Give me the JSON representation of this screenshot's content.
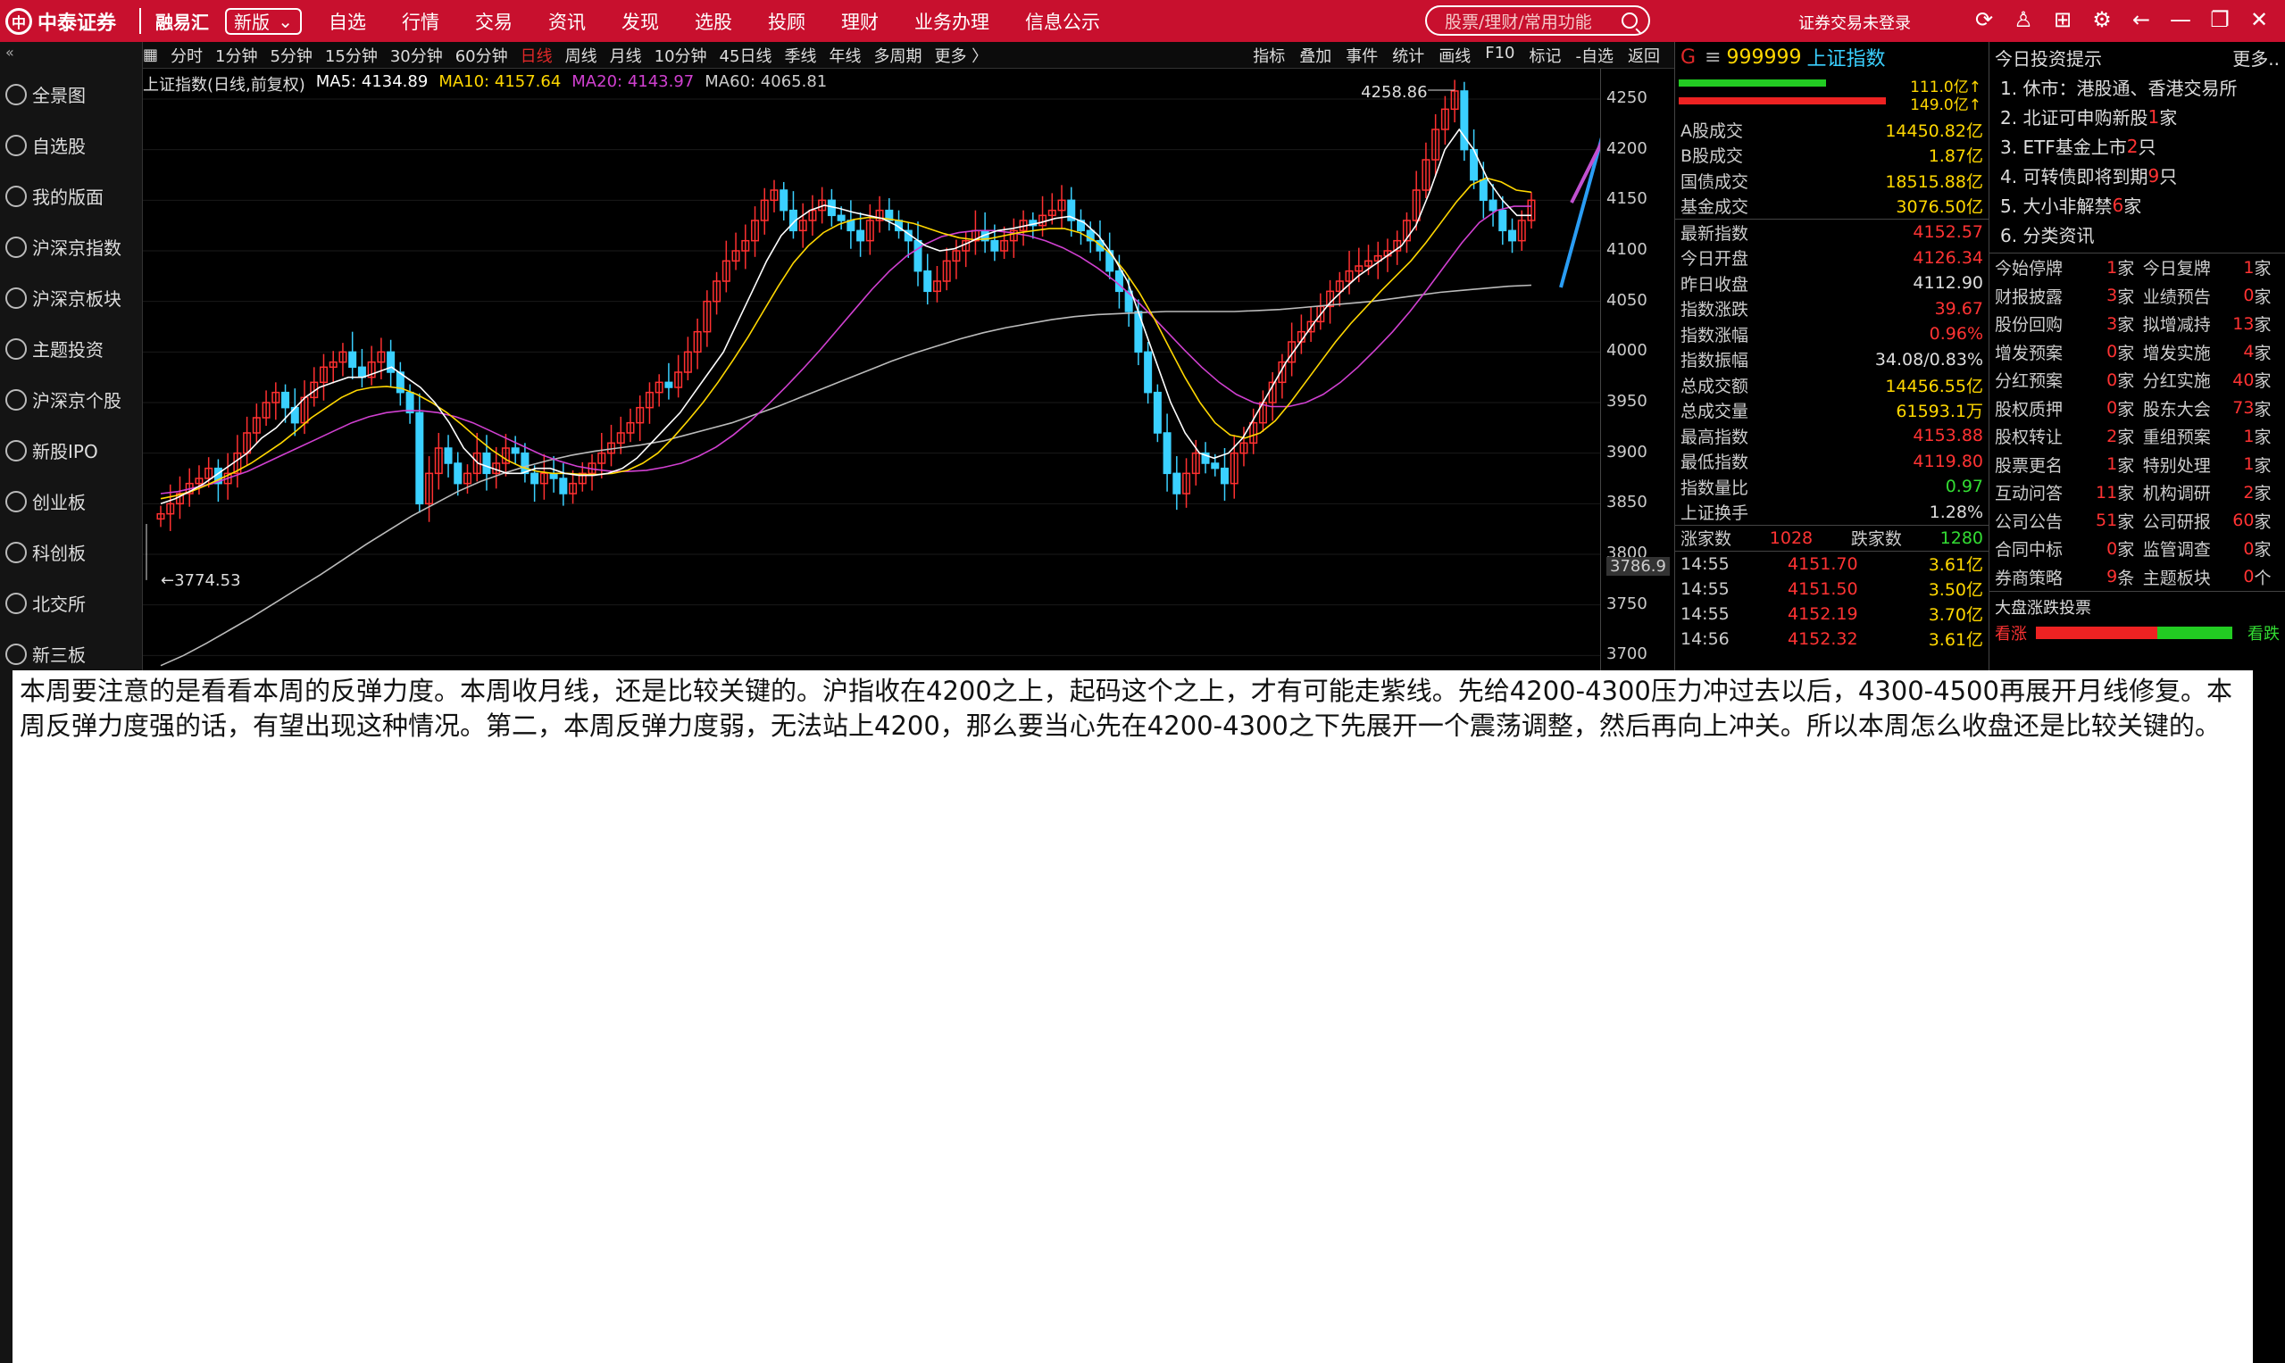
{
  "topbar": {
    "brand": "中泰证券",
    "app": "融易汇",
    "version": "新版",
    "menu": [
      "自选",
      "行情",
      "交易",
      "资讯",
      "发现",
      "选股",
      "投顾",
      "理财",
      "业务办理",
      "信息公示"
    ],
    "search_placeholder": "股票/理财/常用功能",
    "login_status": "证券交易未登录"
  },
  "sidebar": {
    "items": [
      "全景图",
      "自选股",
      "我的版面",
      "沪深京指数",
      "沪深京板块",
      "主题投资",
      "沪深京个股",
      "新股IPO",
      "创业板",
      "科创板",
      "北交所",
      "新三板"
    ]
  },
  "toolbar": {
    "periods": [
      "分时",
      "1分钟",
      "5分钟",
      "15分钟",
      "30分钟",
      "60分钟",
      "日线",
      "周线",
      "月线",
      "10分钟",
      "45日线",
      "季线",
      "年线",
      "多周期",
      "更多 〉"
    ],
    "active": "日线",
    "tools": [
      "指标",
      "叠加",
      "事件",
      "统计",
      "画线",
      "F10",
      "标记",
      "-自选",
      "返回"
    ]
  },
  "chart": {
    "title": "上证指数(日线,前复权)",
    "ma5": "MA5: 4134.89",
    "ma10": "MA10: 4157.64",
    "ma20": "MA20: 4143.97",
    "ma60": "MA60: 4065.81",
    "high_label": "4258.86",
    "low_label": "3774.53",
    "cursor_price": "3786.9",
    "y_ticks": [
      "4250",
      "4200",
      "4150",
      "4100",
      "4050",
      "4000",
      "3950",
      "3900",
      "3850",
      "3800",
      "3750",
      "3700"
    ],
    "colors": {
      "up": "#ff3030",
      "down": "#3ad0ff",
      "ma5": "#ffffff",
      "ma10": "#ffd700",
      "ma20": "#d040d0",
      "ma60": "#bbbbbb"
    }
  },
  "chart_data": {
    "type": "candlestick",
    "title": "上证指数(日线,前复权)",
    "ylim": [
      3680,
      4280
    ],
    "y_ticks": [
      3700,
      3750,
      3800,
      3850,
      3900,
      3950,
      4000,
      4050,
      4100,
      4150,
      4200,
      4250
    ],
    "close": [
      3840,
      3850,
      3860,
      3870,
      3875,
      3885,
      3870,
      3880,
      3900,
      3920,
      3935,
      3950,
      3960,
      3945,
      3930,
      3955,
      3970,
      3985,
      3990,
      4000,
      3985,
      3975,
      3990,
      4000,
      3980,
      3960,
      3940,
      3850,
      3880,
      3905,
      3890,
      3870,
      3880,
      3900,
      3880,
      3890,
      3905,
      3900,
      3880,
      3870,
      3880,
      3875,
      3860,
      3870,
      3880,
      3890,
      3900,
      3910,
      3920,
      3930,
      3945,
      3960,
      3970,
      3965,
      3980,
      4000,
      4020,
      4050,
      4070,
      4090,
      4100,
      4110,
      4130,
      4150,
      4160,
      4140,
      4120,
      4130,
      4140,
      4150,
      4135,
      4130,
      4120,
      4110,
      4130,
      4140,
      4130,
      4120,
      4110,
      4080,
      4060,
      4070,
      4090,
      4100,
      4110,
      4120,
      4110,
      4100,
      4110,
      4120,
      4130,
      4125,
      4135,
      4140,
      4150,
      4130,
      4120,
      4110,
      4100,
      4080,
      4060,
      4040,
      4000,
      3960,
      3920,
      3880,
      3860,
      3880,
      3900,
      3890,
      3885,
      3870,
      3900,
      3910,
      3930,
      3950,
      3970,
      3990,
      4010,
      4020,
      4030,
      4045,
      4060,
      4070,
      4080,
      4085,
      4090,
      4095,
      4100,
      4110,
      4130,
      4160,
      4190,
      4220,
      4240,
      4258,
      4200,
      4170,
      4150,
      4140,
      4120,
      4110,
      4130,
      4150
    ],
    "ma5": [
      3850,
      3855,
      3862,
      3870,
      3880,
      3890,
      3900,
      3915,
      3925,
      3940,
      3955,
      3965,
      3970,
      3975,
      3975,
      3980,
      3985,
      3975,
      3965,
      3950,
      3930,
      3905,
      3890,
      3885,
      3880,
      3880,
      3885,
      3885,
      3880,
      3878,
      3878,
      3880,
      3885,
      3895,
      3910,
      3925,
      3940,
      3960,
      3980,
      4000,
      4030,
      4060,
      4090,
      4115,
      4130,
      4140,
      4145,
      4142,
      4138,
      4135,
      4132,
      4125,
      4115,
      4105,
      4100,
      4102,
      4108,
      4115,
      4120,
      4122,
      4125,
      4128,
      4132,
      4134,
      4128,
      4115,
      4095,
      4070,
      4030,
      3990,
      3950,
      3920,
      3900,
      3895,
      3900,
      3915,
      3940,
      3965,
      3990,
      4010,
      4030,
      4048,
      4062,
      4075,
      4085,
      4095,
      4105,
      4125,
      4160,
      4200,
      4220,
      4200,
      4170,
      4150,
      4135,
      4135
    ],
    "ma10": [
      3855,
      3858,
      3862,
      3868,
      3875,
      3882,
      3890,
      3900,
      3910,
      3922,
      3935,
      3945,
      3955,
      3962,
      3965,
      3966,
      3964,
      3958,
      3950,
      3940,
      3928,
      3915,
      3903,
      3893,
      3886,
      3882,
      3880,
      3880,
      3879,
      3879,
      3880,
      3883,
      3890,
      3900,
      3915,
      3932,
      3950,
      3970,
      3992,
      4015,
      4040,
      4065,
      4088,
      4105,
      4118,
      4126,
      4131,
      4133,
      4132,
      4130,
      4127,
      4122,
      4117,
      4113,
      4111,
      4112,
      4115,
      4118,
      4120,
      4122,
      4122,
      4118,
      4110,
      4098,
      4080,
      4058,
      4032,
      4003,
      3975,
      3950,
      3930,
      3918,
      3915,
      3920,
      3932,
      3950,
      3970,
      3990,
      4010,
      4028,
      4044,
      4060,
      4075,
      4090,
      4108,
      4128,
      4148,
      4165,
      4172,
      4168,
      4160,
      4158
    ],
    "ma20": [
      3860,
      3862,
      3866,
      3870,
      3876,
      3882,
      3890,
      3898,
      3906,
      3914,
      3922,
      3930,
      3936,
      3940,
      3942,
      3942,
      3940,
      3936,
      3930,
      3922,
      3914,
      3906,
      3898,
      3892,
      3887,
      3884,
      3882,
      3882,
      3883,
      3886,
      3890,
      3897,
      3906,
      3918,
      3932,
      3948,
      3965,
      3983,
      4002,
      4022,
      4042,
      4062,
      4080,
      4095,
      4106,
      4114,
      4118,
      4120,
      4120,
      4118,
      4115,
      4110,
      4103,
      4094,
      4083,
      4070,
      4055,
      4038,
      4020,
      4002,
      3985,
      3970,
      3958,
      3950,
      3946,
      3946,
      3950,
      3958,
      3970,
      3985,
      4002,
      4020,
      4040,
      4062,
      4085,
      4108,
      4128,
      4140,
      4144,
      4144
    ],
    "ma60": [
      3690,
      3700,
      3712,
      3725,
      3738,
      3752,
      3766,
      3780,
      3795,
      3810,
      3824,
      3838,
      3850,
      3862,
      3872,
      3880,
      3887,
      3893,
      3898,
      3902,
      3905,
      3908,
      3912,
      3918,
      3924,
      3930,
      3938,
      3946,
      3955,
      3964,
      3973,
      3982,
      3991,
      3999,
      4006,
      4013,
      4019,
      4024,
      4028,
      4032,
      4035,
      4037,
      4038,
      4039,
      4040,
      4040,
      4040,
      4040,
      4041,
      4042,
      4044,
      4046,
      4048,
      4050,
      4053,
      4056,
      4059,
      4061,
      4063,
      4065,
      4066
    ]
  },
  "info": {
    "g": "G",
    "code": "999999",
    "name": "上证指数",
    "bar1_value": "111.0亿↑",
    "bar2_value": "149.0亿↑",
    "turnovers": [
      {
        "label": "A股成交",
        "value": "14450.82亿"
      },
      {
        "label": "B股成交",
        "value": "1.87亿"
      },
      {
        "label": "国债成交",
        "value": "18515.88亿"
      },
      {
        "label": "基金成交",
        "value": "3076.50亿"
      }
    ],
    "stats": [
      {
        "label": "最新指数",
        "value": "4152.57",
        "color": "red"
      },
      {
        "label": "今日开盘",
        "value": "4126.34",
        "color": "red"
      },
      {
        "label": "昨日收盘",
        "value": "4112.90",
        "color": "white"
      },
      {
        "label": "指数涨跌",
        "value": "39.67",
        "color": "red"
      },
      {
        "label": "指数涨幅",
        "value": "0.96%",
        "color": "red"
      },
      {
        "label": "指数振幅",
        "value": "34.08/0.83%",
        "color": "white"
      },
      {
        "label": "总成交额",
        "value": "14456.55亿",
        "color": "yellow"
      },
      {
        "label": "总成交量",
        "value": "61593.1万",
        "color": "yellow"
      },
      {
        "label": "最高指数",
        "value": "4153.88",
        "color": "red"
      },
      {
        "label": "最低指数",
        "value": "4119.80",
        "color": "red"
      },
      {
        "label": "指数量比",
        "value": "0.97",
        "color": "green"
      },
      {
        "label": "上证换手",
        "value": "1.28%",
        "color": "white"
      }
    ],
    "up_label": "涨家数",
    "up_count": "1028",
    "down_label": "跌家数",
    "down_count": "1280",
    "ticks": [
      {
        "t": "14:55",
        "p": "4151.70",
        "v": "3.61亿"
      },
      {
        "t": "14:55",
        "p": "4151.50",
        "v": "3.50亿"
      },
      {
        "t": "14:55",
        "p": "4152.19",
        "v": "3.70亿"
      },
      {
        "t": "14:56",
        "p": "4152.32",
        "v": "3.61亿"
      }
    ]
  },
  "tips": {
    "title": "今日投资提示",
    "more": "更多..",
    "items": [
      {
        "pre": "1. 休市：港股通、香港交易所",
        "num": "",
        "post": ""
      },
      {
        "pre": "2. 北证可申购新股",
        "num": "1",
        "post": "家"
      },
      {
        "pre": "3. ETF基金上市",
        "num": "2",
        "post": "只"
      },
      {
        "pre": "4. 可转债即将到期",
        "num": "9",
        "post": "只"
      },
      {
        "pre": "5. 大小非解禁",
        "num": "6",
        "post": "家"
      },
      {
        "pre": "6. 分类资讯",
        "num": "",
        "post": ""
      }
    ],
    "events": [
      {
        "a": "今始停牌",
        "av": "1",
        "au": "家",
        "b": "今日复牌",
        "bv": "1",
        "bu": "家"
      },
      {
        "a": "财报披露",
        "av": "3",
        "au": "家",
        "b": "业绩预告",
        "bv": "0",
        "bu": "家"
      },
      {
        "a": "股份回购",
        "av": "3",
        "au": "家",
        "b": "拟增减持",
        "bv": "13",
        "bu": "家"
      },
      {
        "a": "增发预案",
        "av": "0",
        "au": "家",
        "b": "增发实施",
        "bv": "4",
        "bu": "家"
      },
      {
        "a": "分红预案",
        "av": "0",
        "au": "家",
        "b": "分红实施",
        "bv": "40",
        "bu": "家"
      },
      {
        "a": "股权质押",
        "av": "0",
        "au": "家",
        "b": "股东大会",
        "bv": "73",
        "bu": "家"
      },
      {
        "a": "股权转让",
        "av": "2",
        "au": "家",
        "b": "重组预案",
        "bv": "1",
        "bu": "家"
      },
      {
        "a": "股票更名",
        "av": "1",
        "au": "家",
        "b": "特别处理",
        "bv": "1",
        "bu": "家"
      },
      {
        "a": "互动问答",
        "av": "11",
        "au": "家",
        "b": "机构调研",
        "bv": "2",
        "bu": "家"
      },
      {
        "a": "公司公告",
        "av": "51",
        "au": "家",
        "b": "公司研报",
        "bv": "60",
        "bu": "家"
      },
      {
        "a": "合同中标",
        "av": "0",
        "au": "家",
        "b": "监管调查",
        "bv": "0",
        "bu": "家"
      },
      {
        "a": "券商策略",
        "av": "9",
        "au": "条",
        "b": "主题板块",
        "bv": "0",
        "bu": "个"
      }
    ],
    "vote_title": "大盘涨跌投票",
    "vote_up": "看涨",
    "vote_down": "看跌",
    "vote_up_fraction": 0.62
  },
  "note": "本周要注意的是看看本周的反弹力度。本周收月线，还是比较关键的。沪指收在4200之上，起码这个之上，才有可能走紫线。先给4200-4300压力冲过去以后，4300-4500再展开月线修复。本周反弹力度强的话，有望出现这种情况。第二，本周反弹力度弱，无法站上4200，那么要当心先在4200-4300之下先展开一个震荡调整，然后再向上冲关。所以本周怎么收盘还是比较关键的。"
}
